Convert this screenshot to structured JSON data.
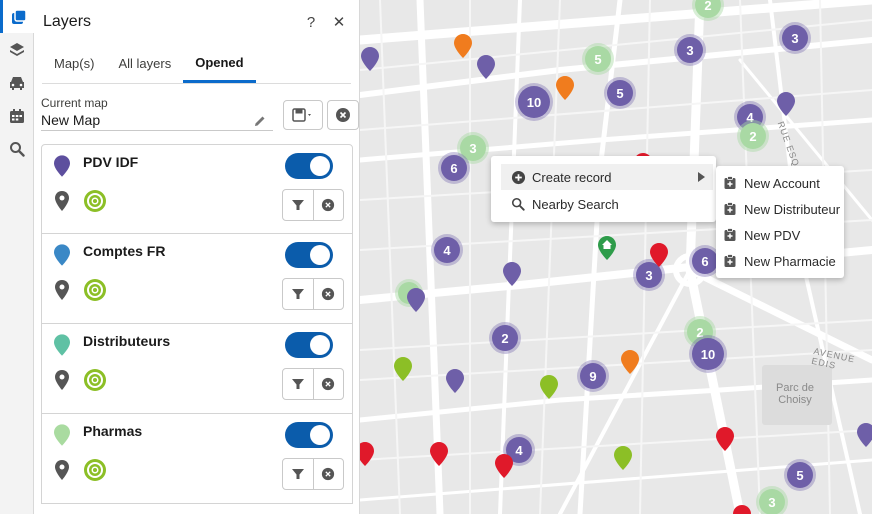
{
  "panel": {
    "title": "Layers",
    "help_icon": "?",
    "close_icon": "✕",
    "tabs": [
      {
        "label": "Map(s)"
      },
      {
        "label": "All layers"
      },
      {
        "label": "Opened"
      }
    ],
    "current_map_label": "Current map",
    "current_map_name": "New Map"
  },
  "layers": [
    {
      "name": "PDV IDF",
      "pin_color": "#5d4f9e",
      "enabled": true
    },
    {
      "name": "Comptes FR",
      "pin_color": "#3a88c6",
      "enabled": true
    },
    {
      "name": "Distributeurs",
      "pin_color": "#5fc1a4",
      "enabled": true
    },
    {
      "name": "Pharmas",
      "pin_color": "#a9dba0",
      "enabled": true
    }
  ],
  "context_menu": {
    "items": [
      {
        "label": "Create record",
        "icon": "plus-circle-icon"
      },
      {
        "label": "Nearby Search",
        "icon": "search-icon"
      }
    ],
    "submenu": [
      {
        "label": "New Account"
      },
      {
        "label": "New Distributeur"
      },
      {
        "label": "New PDV"
      },
      {
        "label": "New Pharmacie"
      }
    ]
  },
  "map": {
    "labels": {
      "park": "Parc de\nChoisy",
      "street1": "RUE ESQ",
      "street2": "AVENUE EDIS"
    },
    "clusters": [
      {
        "count": "2",
        "color": "green"
      },
      {
        "count": "3",
        "color": "purple"
      },
      {
        "count": "3",
        "color": "purple"
      },
      {
        "count": "5",
        "color": "green"
      },
      {
        "count": "10",
        "color": "purple"
      },
      {
        "count": "5",
        "color": "purple"
      },
      {
        "count": "4",
        "color": "purple"
      },
      {
        "count": "2",
        "color": "green"
      },
      {
        "count": "3",
        "color": "green"
      },
      {
        "count": "6",
        "color": "purple"
      },
      {
        "count": "4",
        "color": "purple"
      },
      {
        "count": "3",
        "color": "purple"
      },
      {
        "count": "6",
        "color": "purple"
      },
      {
        "count": "2",
        "color": "purple"
      },
      {
        "count": "2",
        "color": "green"
      },
      {
        "count": "10",
        "color": "purple"
      },
      {
        "count": "9",
        "color": "purple"
      },
      {
        "count": "4",
        "color": "purple"
      },
      {
        "count": "5",
        "color": "purple"
      },
      {
        "count": "3",
        "color": "green"
      }
    ],
    "colors": {
      "purple": "#6e5fa8",
      "orange": "#f07c1e",
      "red": "#e0192a",
      "lime": "#8cbf26",
      "home": "#2e9c4a"
    }
  }
}
